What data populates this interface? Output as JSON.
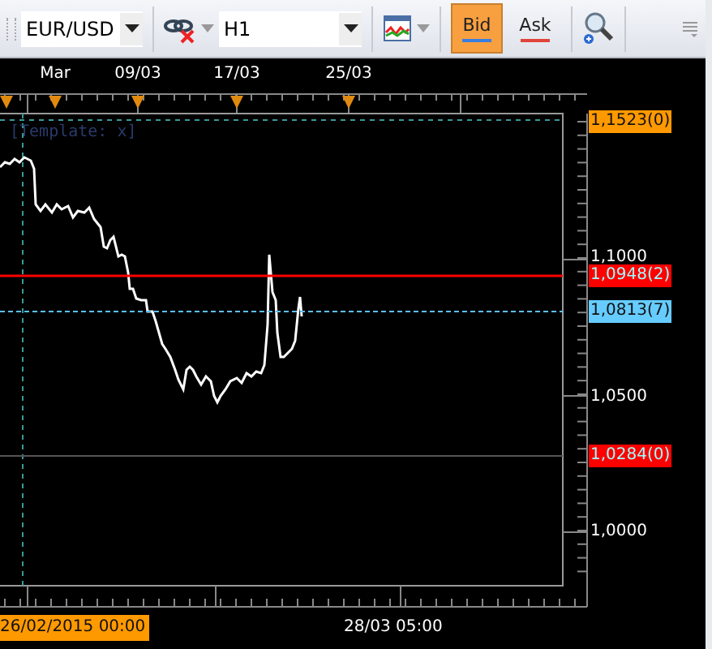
{
  "toolbar": {
    "symbol": "EUR/USD",
    "timeframe": "H1",
    "price_buttons": [
      {
        "label": "Bid",
        "selected": true,
        "color": "#3a7ee0"
      },
      {
        "label": "Ask",
        "selected": false,
        "color": "#e0443a"
      }
    ]
  },
  "chart": {
    "time_labels": [
      "Mar",
      "09/03",
      "17/03",
      "25/03"
    ],
    "template_label": "[Template: x]",
    "price_labels": [
      {
        "text": "1,1523(0)",
        "kind": "marker",
        "color": "#ff9900"
      },
      {
        "text": "1,1000",
        "kind": "tick"
      },
      {
        "text": "1,0948(2)",
        "kind": "marker",
        "color": "#ff0000"
      },
      {
        "text": "1,0813(7)",
        "kind": "marker",
        "color": "#66ccff"
      },
      {
        "text": "1,0500",
        "kind": "tick"
      },
      {
        "text": "1,0284(0)",
        "kind": "marker",
        "color": "#ff0000"
      },
      {
        "text": "1,0000",
        "kind": "tick"
      }
    ],
    "start_time": "26/02/2015 00:00",
    "cursor_time": "28/03 05:00"
  }
}
